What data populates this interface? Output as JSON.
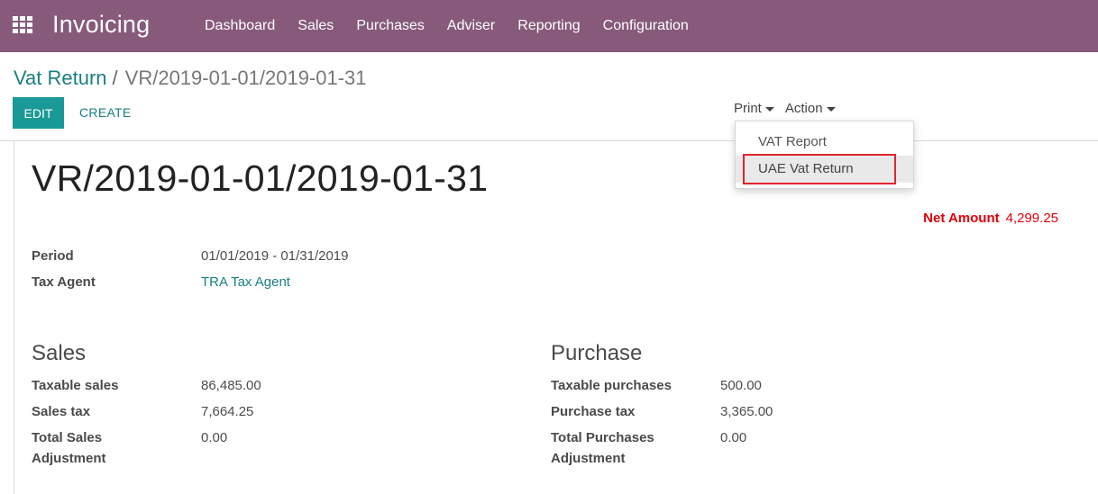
{
  "navbar": {
    "app_name": "Invoicing",
    "menu": [
      "Dashboard",
      "Sales",
      "Purchases",
      "Adviser",
      "Reporting",
      "Configuration"
    ]
  },
  "breadcrumb": {
    "parent": "Vat Return",
    "separator": "/",
    "current": "VR/2019-01-01/2019-01-31"
  },
  "buttons": {
    "edit": "EDIT",
    "create": "CREATE",
    "print": "Print",
    "action": "Action"
  },
  "print_menu": {
    "items": [
      "VAT Report",
      "UAE Vat Return"
    ],
    "highlighted": "UAE Vat Return"
  },
  "form": {
    "title": "VR/2019-01-01/2019-01-31",
    "net_amount_label": "Net Amount",
    "net_amount_value": "4,299.25",
    "period_label": "Period",
    "period_value": "01/01/2019 - 01/31/2019",
    "tax_agent_label": "Tax Agent",
    "tax_agent_value": "TRA Tax Agent",
    "sales": {
      "title": "Sales",
      "taxable_label": "Taxable sales",
      "taxable_value": "86,485.00",
      "tax_label": "Sales tax",
      "tax_value": "7,664.25",
      "adjust_label_1": "Total Sales",
      "adjust_label_2": "Adjustment",
      "adjust_value": "0.00"
    },
    "purchase": {
      "title": "Purchase",
      "taxable_label": "Taxable purchases",
      "taxable_value": "500.00",
      "tax_label": "Purchase tax",
      "tax_value": "3,365.00",
      "adjust_label_1": "Total Purchases",
      "adjust_label_2": "Adjustment",
      "adjust_value": "0.00"
    }
  },
  "colors": {
    "navbar": "#875a7b",
    "accent": "#00a09d",
    "net_amount": "#e0000a",
    "highlight_border": "#e0242f"
  }
}
